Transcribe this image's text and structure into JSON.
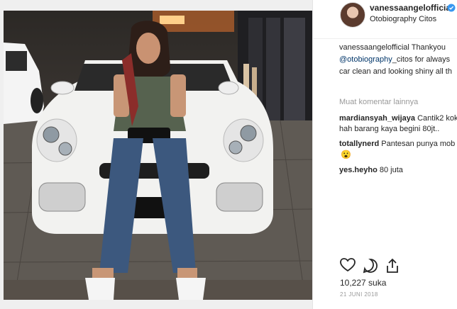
{
  "post": {
    "photo_alt": "Woman in green top and jeans sitting on the hood of a white sports car"
  },
  "author": {
    "username": "vanessaangelofficial",
    "location": "Otobiography Citos"
  },
  "caption": {
    "line1": "vanessaangelofficial Thankyou",
    "mention": "@otobiography",
    "line2_rest": "_citos for always",
    "line3": "car clean and looking shiny all th"
  },
  "more_comments": "Muat komentar lainnya",
  "comments": [
    {
      "user": "mardiansyah_wijaya",
      "text": "Cantik2 kok",
      "text2": "hah barang kaya begini 80jt.."
    },
    {
      "user": "totallynerd",
      "text": "Pantesan punya mob",
      "emoji": "😮"
    },
    {
      "user": "yes.heyho",
      "text": "80 juta"
    }
  ],
  "likes": "10,227 suka",
  "date": "21 JUNI 2018",
  "colors": {
    "verified": "#3897f0",
    "car": "#f2f2f0",
    "top": "#56624f",
    "jeans": "#3c587e"
  }
}
